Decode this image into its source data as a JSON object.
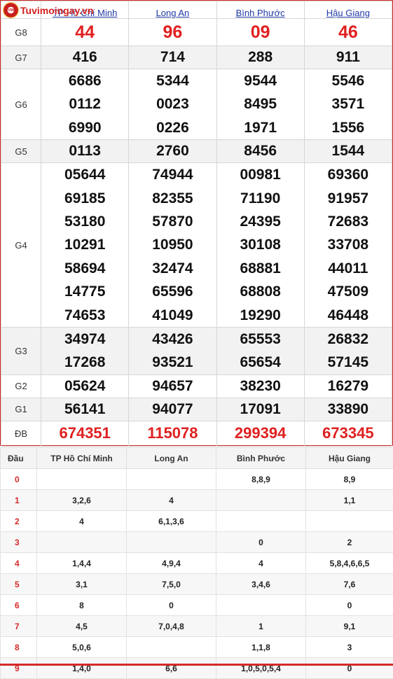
{
  "site": {
    "logo_text": "Tuvimoingay.vn",
    "logo_mark": "TVMN"
  },
  "provinces": [
    "TP Hồ Chí Minh",
    "Long An",
    "Bình Phước",
    "Hậu Giang"
  ],
  "results": {
    "g8": {
      "label": "G8",
      "values": [
        "44",
        "96",
        "09",
        "46"
      ]
    },
    "g7": {
      "label": "G7",
      "values": [
        "416",
        "714",
        "288",
        "911"
      ]
    },
    "g6": {
      "label": "G6",
      "values": [
        [
          "6686",
          "0112",
          "6990"
        ],
        [
          "5344",
          "0023",
          "0226"
        ],
        [
          "9544",
          "8495",
          "1971"
        ],
        [
          "5546",
          "3571",
          "1556"
        ]
      ]
    },
    "g5": {
      "label": "G5",
      "values": [
        "0113",
        "2760",
        "8456",
        "1544"
      ]
    },
    "g4": {
      "label": "G4",
      "values": [
        [
          "05644",
          "69185",
          "53180",
          "10291",
          "58694",
          "14775",
          "74653"
        ],
        [
          "74944",
          "82355",
          "57870",
          "10950",
          "32474",
          "65596",
          "41049"
        ],
        [
          "00981",
          "71190",
          "24395",
          "30108",
          "68881",
          "68808",
          "19290"
        ],
        [
          "69360",
          "91957",
          "72683",
          "33708",
          "44011",
          "47509",
          "46448"
        ]
      ]
    },
    "g3": {
      "label": "G3",
      "values": [
        [
          "34974",
          "17268"
        ],
        [
          "43426",
          "93521"
        ],
        [
          "65553",
          "65654"
        ],
        [
          "26832",
          "57145"
        ]
      ]
    },
    "g2": {
      "label": "G2",
      "values": [
        "05624",
        "94657",
        "38230",
        "16279"
      ]
    },
    "g1": {
      "label": "G1",
      "values": [
        "56141",
        "94077",
        "17091",
        "33890"
      ]
    },
    "db": {
      "label": "ĐB",
      "values": [
        "674351",
        "115078",
        "299394",
        "673345"
      ]
    }
  },
  "dau": {
    "header": "Đầu",
    "columns": [
      "TP Hồ Chí Minh",
      "Long An",
      "Bình Phước",
      "Hậu Giang"
    ],
    "rows": [
      {
        "head": "0",
        "cells": [
          "",
          "",
          "8,8,9",
          "8,9"
        ]
      },
      {
        "head": "1",
        "cells": [
          "3,2,6",
          "4",
          "",
          "1,1"
        ]
      },
      {
        "head": "2",
        "cells": [
          "4",
          "6,1,3,6",
          "",
          ""
        ]
      },
      {
        "head": "3",
        "cells": [
          "",
          "",
          "0",
          "2"
        ]
      },
      {
        "head": "4",
        "cells": [
          "1,4,4",
          "4,9,4",
          "4",
          "5,8,4,6,6,5"
        ]
      },
      {
        "head": "5",
        "cells": [
          "3,1",
          "7,5,0",
          "3,4,6",
          "7,6"
        ]
      },
      {
        "head": "6",
        "cells": [
          "8",
          "0",
          "",
          "0"
        ]
      },
      {
        "head": "7",
        "cells": [
          "4,5",
          "7,0,4,8",
          "1",
          "9,1"
        ]
      },
      {
        "head": "8",
        "cells": [
          "5,0,6",
          "",
          "1,1,8",
          "3"
        ]
      },
      {
        "head": "9",
        "cells": [
          "1,4,0",
          "6,6",
          "1,0,5,0,5,4",
          "0"
        ]
      }
    ]
  },
  "colors": {
    "accent_red": "#e02020",
    "link_blue": "#1f39a6",
    "border_red": "#d42b2b"
  }
}
